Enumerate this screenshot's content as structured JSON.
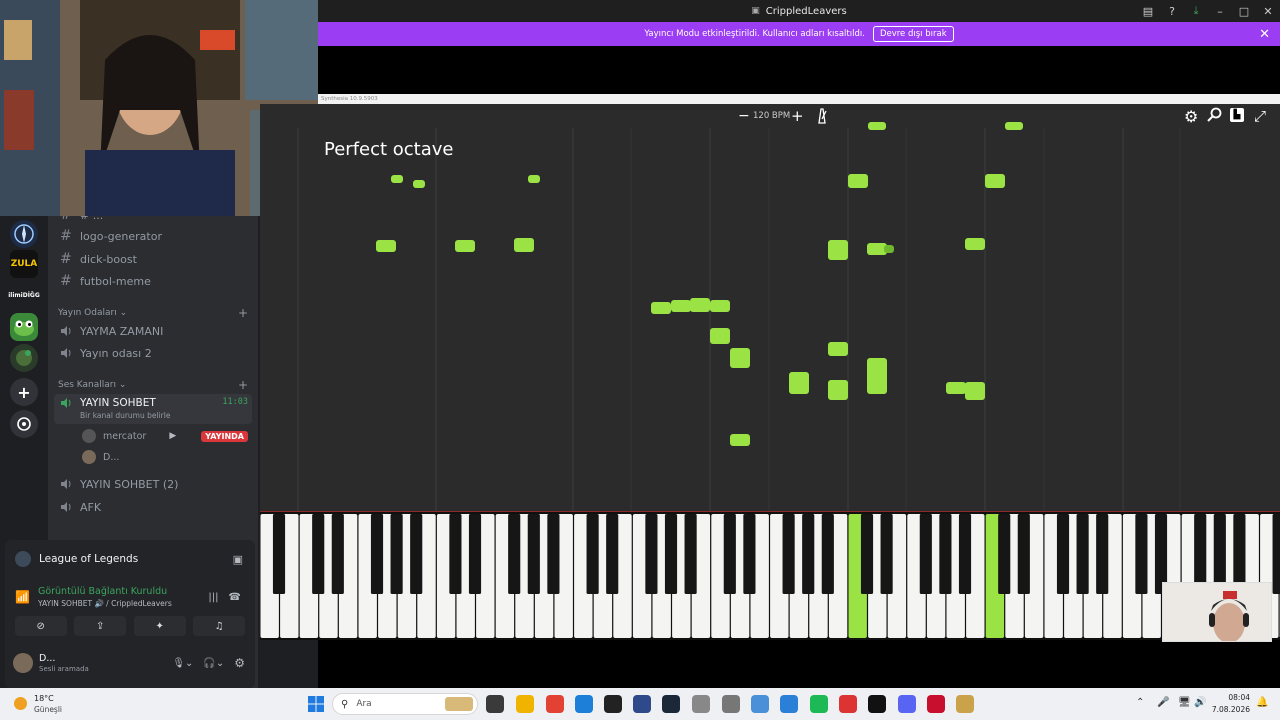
{
  "window": {
    "title": "CrippledLeavers"
  },
  "stream_banner": {
    "message": "Yayıncı Modu etkinleştirildi. Kullanıcı adları kısaltıldı.",
    "disable_label": "Devre dışı bırak"
  },
  "synthesia": {
    "version": "Synthesia 10.9.5903",
    "bpm_label": "120 BPM",
    "overlay_text": "Perfect octave"
  },
  "discord": {
    "servers": [
      "ZULA",
      "ilimiDİĞG"
    ],
    "channels": [
      {
        "name": "# ...",
        "partial": true
      },
      {
        "name": "logo-generator"
      },
      {
        "name": "dick-boost"
      },
      {
        "name": "futbol-meme"
      }
    ],
    "category_stream": "Yayın Odaları",
    "stream_rooms": [
      "YAYMA ZAMANI",
      "Yayın odası 2"
    ],
    "category_voice": "Ses Kanalları",
    "active_voice": {
      "name": "YAYIN SOHBET",
      "time": "11:03",
      "status_hint": "Bir kanal durumu belirle"
    },
    "voice_users": [
      {
        "name": "mercator",
        "live": "YAYINDA"
      },
      {
        "name": "D..."
      }
    ],
    "other_voice": [
      "YAYIN SOHBET (2)",
      "AFK"
    ],
    "activity": "League of Legends",
    "connection": {
      "status": "Görüntülü Bağlantı Kuruldu",
      "detail": "YAYIN SOHBET 🔊 / CrippledLeavers"
    },
    "user": {
      "name": "D...",
      "status": "Sesli aramada"
    }
  },
  "taskbar": {
    "weather_temp": "18°C",
    "weather_desc": "Güneşli",
    "search_placeholder": "Ara",
    "time": "08:04",
    "date": "7.08.2026"
  },
  "colors": {
    "note_green": "#9be345",
    "stream_purple": "#9b3df2",
    "roll_bg": "#2b2b2b"
  }
}
